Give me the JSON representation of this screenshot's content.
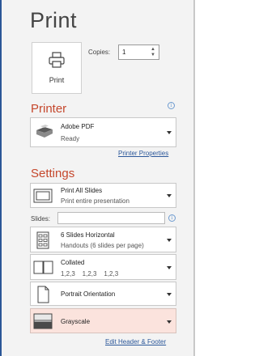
{
  "title": "Print",
  "print_button": {
    "label": "Print",
    "icon": "printer-icon"
  },
  "copies": {
    "label": "Copies:",
    "value": "1"
  },
  "printer": {
    "heading": "Printer",
    "name": "Adobe PDF",
    "status": "Ready",
    "properties_link": "Printer Properties"
  },
  "settings": {
    "heading": "Settings",
    "slides_range": {
      "title": "Print All Slides",
      "subtitle": "Print entire presentation"
    },
    "slides_label": "Slides:",
    "slides_value": "",
    "layout": {
      "title": "6 Slides Horizontal",
      "subtitle": "Handouts (6 slides per page)"
    },
    "collation": {
      "title": "Collated",
      "subtitle": "1,2,3    1,2,3    1,2,3"
    },
    "orientation": {
      "title": "Portrait Orientation"
    },
    "color": {
      "title": "Grayscale",
      "highlight": "#fbe3dd"
    },
    "header_footer_link": "Edit Header & Footer"
  },
  "colors": {
    "accent": "#c5472c",
    "link": "#2b579a",
    "border": "#2b5797"
  }
}
